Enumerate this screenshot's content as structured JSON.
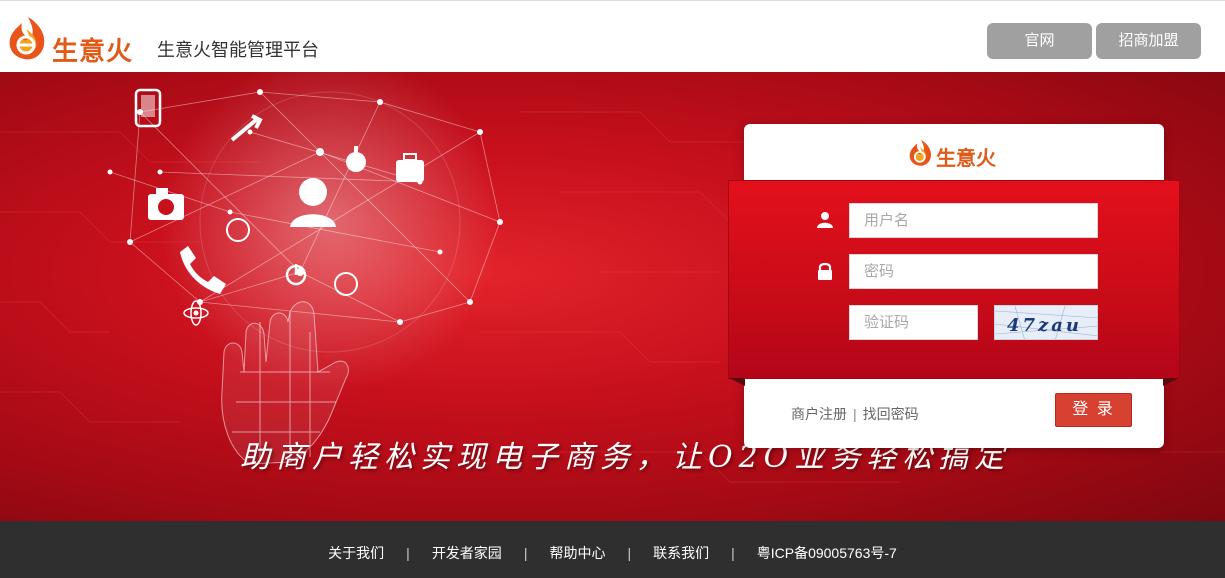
{
  "header": {
    "brand": "生意火",
    "platform_title": "生意火智能管理平台",
    "buttons": {
      "official": "官网",
      "join": "招商加盟"
    }
  },
  "banner": {
    "slogan": "助商户轻松实现电子商务，让O2O业务轻松搞定"
  },
  "login": {
    "brand": "生意火",
    "username_placeholder": "用户名",
    "password_placeholder": "密码",
    "captcha_placeholder": "验证码",
    "captcha_text": "47zau",
    "register_link": "商户注册",
    "link_separator": "|",
    "forgot_link": "找回密码",
    "submit_label": "登 录"
  },
  "footer": {
    "links": [
      "关于我们",
      "开发者家园",
      "帮助中心",
      "联系我们"
    ],
    "separator": "|",
    "icp": "粤ICP备09005763号-7"
  },
  "colors": {
    "brand_orange": "#e05a18",
    "banner_red": "#c8101d",
    "login_button": "#d64131",
    "top_button_gray": "#a0a0a0",
    "footer_bg": "#2f2f2f"
  }
}
